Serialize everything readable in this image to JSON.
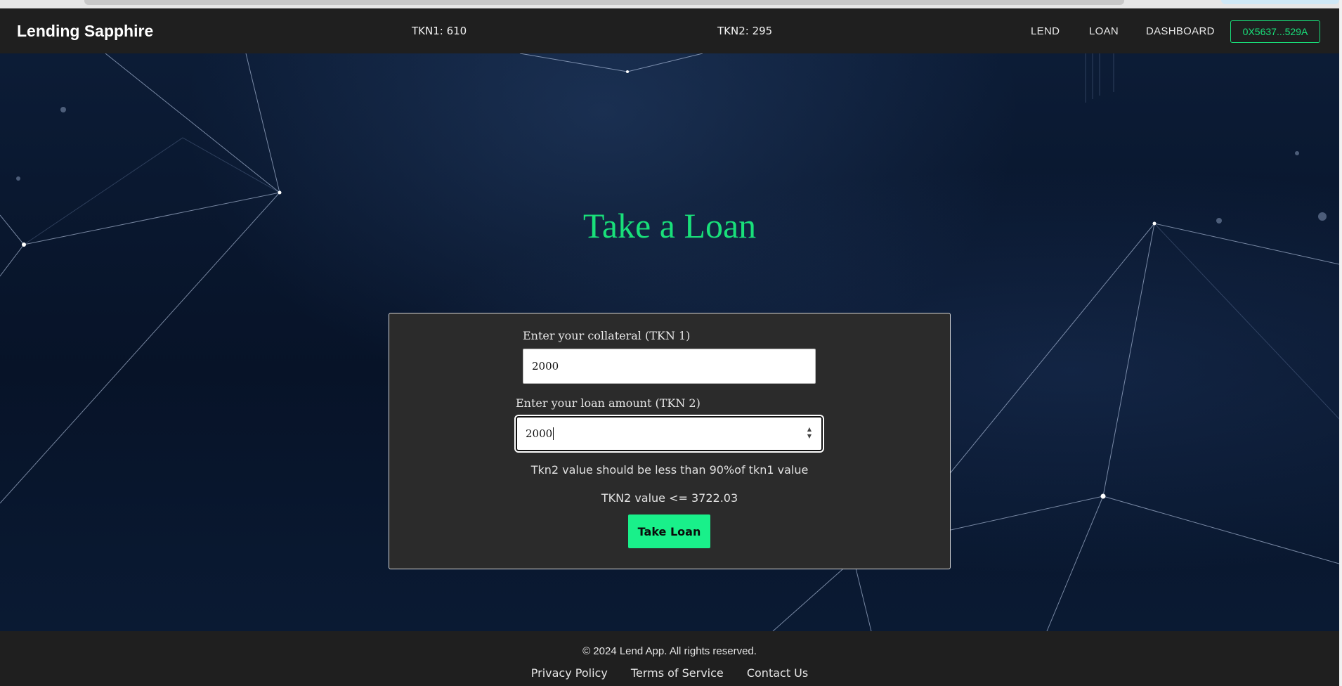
{
  "header": {
    "brand": "Lending Sapphire",
    "tkn1": "TKN1: 610",
    "tkn2": "TKN2: 295",
    "nav": {
      "lend": "LEND",
      "loan": "LOAN",
      "dashboard": "DASHBOARD"
    },
    "wallet": "0X5637...529A"
  },
  "main": {
    "title": "Take a Loan",
    "form": {
      "collateral_label": "Enter your collateral (TKN 1)",
      "collateral_value": "2000",
      "loan_label": "Enter your loan amount (TKN 2)",
      "loan_value": "2000",
      "hint": "Tkn2 value should be less than 90%of tkn1 value",
      "max_text": "TKN2 value <= 3722.03",
      "submit_label": "Take Loan"
    }
  },
  "footer": {
    "copyright": "© 2024 Lend App. All rights reserved.",
    "links": [
      "Privacy Policy",
      "Terms of Service",
      "Contact Us"
    ]
  },
  "colors": {
    "accent": "#19e07a",
    "button": "#19f08a",
    "header_bg": "#1f1f1f",
    "card_bg": "#2b2b2b"
  },
  "icons": {
    "spinner": "number-spinner-icon"
  }
}
